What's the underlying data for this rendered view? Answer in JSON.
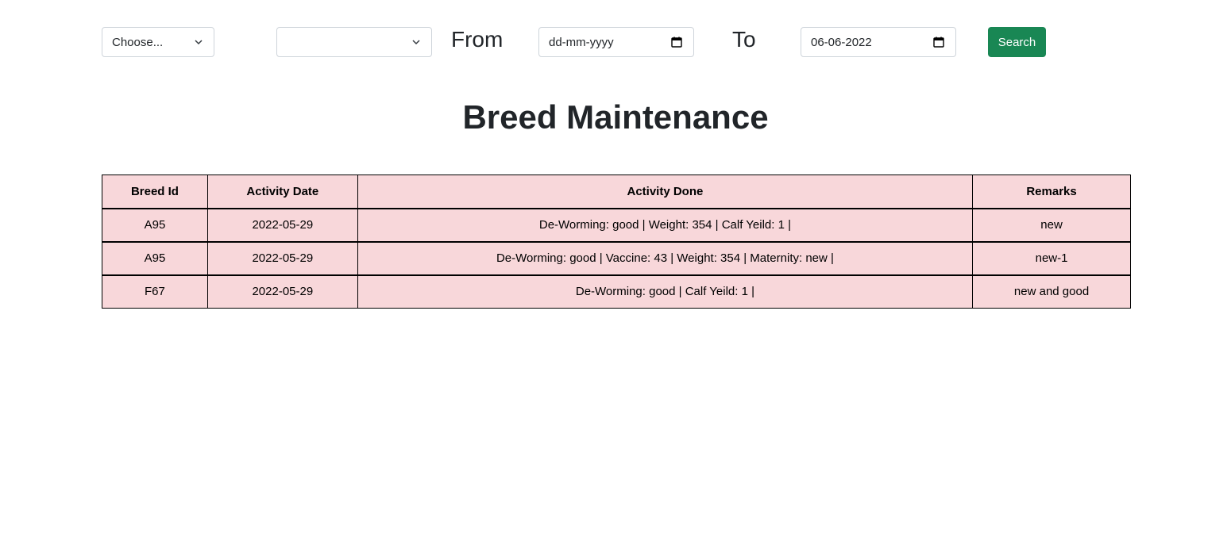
{
  "filters": {
    "category_select": "Choose...",
    "second_select": "",
    "from_label": "From",
    "from_date": "dd-mm-yyyy",
    "to_label": "To",
    "to_date": "06-06-2022",
    "search_label": "Search"
  },
  "page": {
    "title": "Breed Maintenance"
  },
  "table": {
    "headers": [
      "Breed Id",
      "Activity Date",
      "Activity Done",
      "Remarks"
    ],
    "rows": [
      [
        "A95",
        "2022-05-29",
        "De-Worming: good | Weight: 354 | Calf Yeild: 1 |",
        "new"
      ],
      [
        "A95",
        "2022-05-29",
        "De-Worming: good | Vaccine: 43 | Weight: 354 | Maternity: new |",
        "new-1"
      ],
      [
        "F67",
        "2022-05-29",
        "De-Worming: good | Calf Yeild: 1 |",
        "new and good"
      ]
    ]
  },
  "colors": {
    "table_bg": "#f8d7da",
    "button_bg": "#198754"
  }
}
